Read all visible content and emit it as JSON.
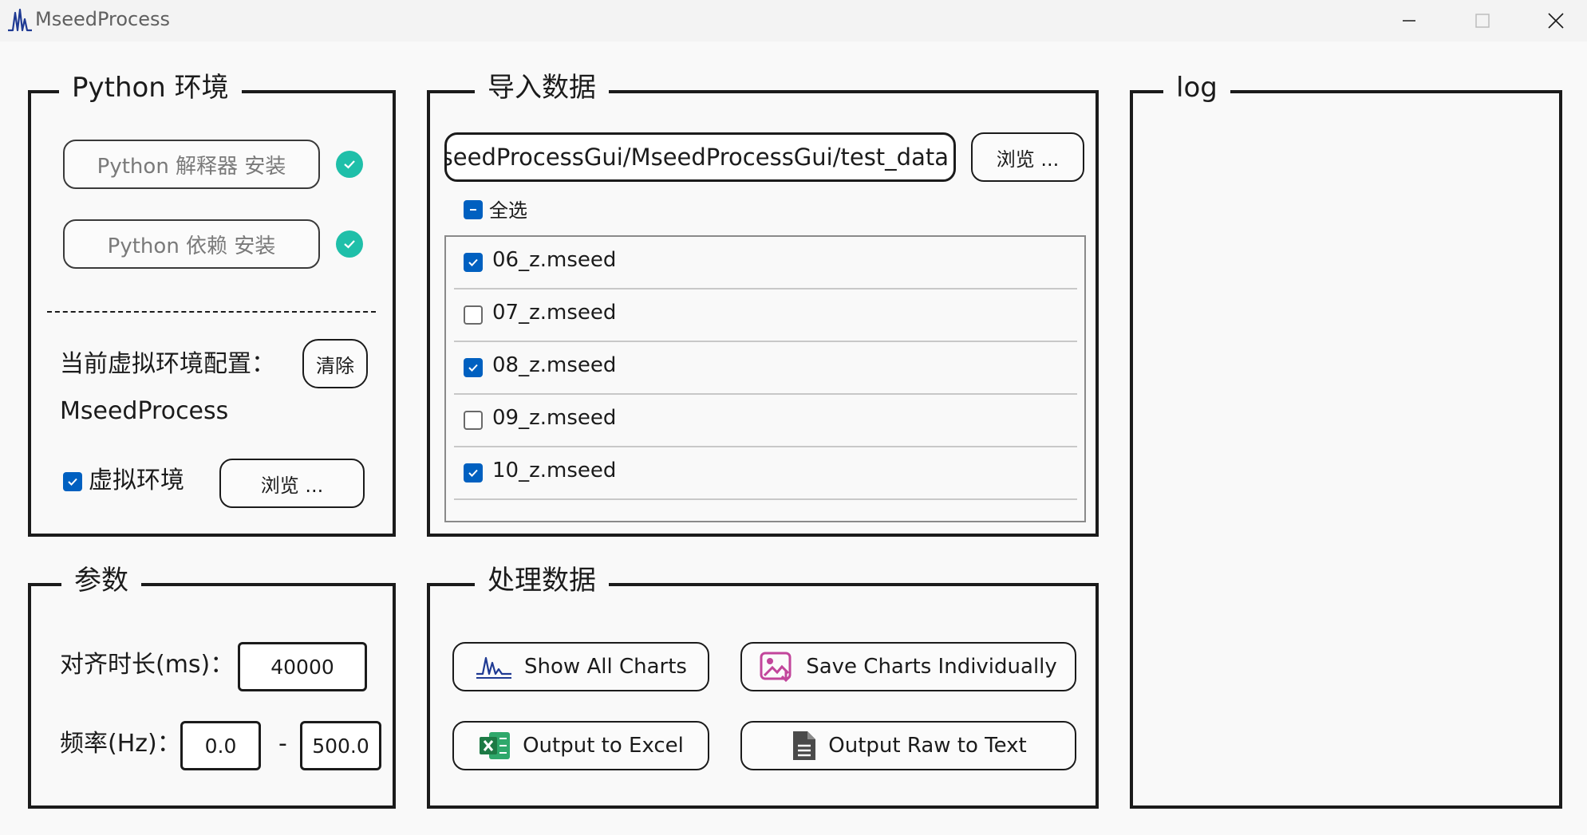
{
  "window": {
    "title": "MseedProcess",
    "app_icon": "waveform-icon",
    "controls": [
      "minimize-icon",
      "maximize-icon",
      "close-icon"
    ]
  },
  "python_env": {
    "legend": "Python 环境",
    "install_interpreter": "Python 解释器 安装",
    "install_deps": "Python 依赖 安装",
    "current_label": "当前虚拟环境配置：",
    "clear_button": "清除",
    "current_value": "MseedProcess",
    "venv_label": "虚拟环境",
    "venv_checked": true,
    "browse_button": "浏览 ..."
  },
  "params": {
    "legend": "参数",
    "align_label": "对齐时长(ms)：",
    "align_value": "40000",
    "freq_label": "频率(Hz)：",
    "freq_min": "0.0",
    "freq_sep": "-",
    "freq_max": "500.0"
  },
  "import": {
    "legend": "导入数据",
    "path_value": "t/MseedProcessGui/MseedProcessGui/test_data",
    "browse_button": "浏览 ...",
    "select_all_label": "全选",
    "files": [
      {
        "name": "06_z.mseed",
        "checked": true
      },
      {
        "name": "07_z.mseed",
        "checked": false
      },
      {
        "name": "08_z.mseed",
        "checked": true
      },
      {
        "name": "09_z.mseed",
        "checked": false
      },
      {
        "name": "10_z.mseed",
        "checked": true
      }
    ]
  },
  "process": {
    "legend": "处理数据",
    "show_all": "Show All Charts",
    "save_individually": "Save Charts Individually",
    "output_excel": "Output to Excel",
    "output_raw": "Output Raw to Text"
  },
  "log": {
    "legend": "log"
  },
  "colors": {
    "accent": "#0060c0",
    "success": "#1fbfa9",
    "chart_icon": "#1f3a93",
    "save_icon": "#c2459b",
    "excel_icon": "#1d7a45",
    "text_icon": "#4a4a4a"
  }
}
